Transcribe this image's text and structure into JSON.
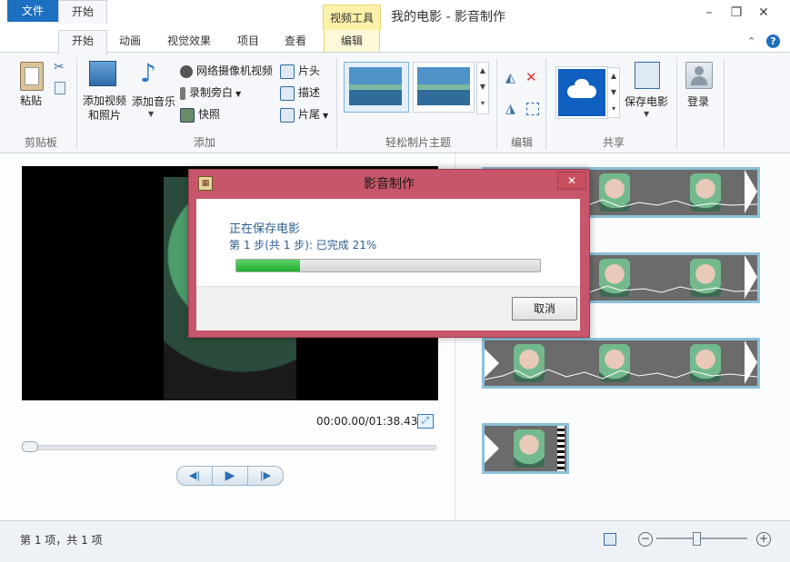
{
  "window": {
    "title": "我的电影 - 影音制作",
    "context_tab_group": "视频工具",
    "minimize": "–",
    "restore": "❐",
    "close": "✕"
  },
  "ribbon_tabs": [
    "文件",
    "开始",
    "动画",
    "视觉效果",
    "项目",
    "查看",
    "编辑"
  ],
  "ribbon": {
    "clipboard": {
      "paste": "粘贴",
      "group": "剪贴板"
    },
    "add": {
      "add_video": "添加视频\n和照片",
      "add_video_line1": "添加视频",
      "add_video_line2": "和照片",
      "add_music": "添加音乐",
      "webcam": "网络摄像机视频",
      "narration": "录制旁白",
      "snapshot": "快照",
      "title": "片头",
      "caption": "描述",
      "credits": "片尾",
      "group": "添加"
    },
    "themes": {
      "group": "轻松制片主题"
    },
    "editing": {
      "group": "编辑"
    },
    "share": {
      "save_movie": "保存电影",
      "group": "共享"
    },
    "signin": {
      "label": "登录"
    }
  },
  "player": {
    "timecode": "00:00.00/01:38.43"
  },
  "status": {
    "text": "第 1 项，共 1 项"
  },
  "dialog": {
    "title": "影音制作",
    "line1": "正在保存电影",
    "line2": "第 1 步(共 1 步): 已完成 21%",
    "progress": 0.21,
    "cancel": "取消",
    "close": "✕"
  },
  "colors": {
    "file_tab": "#1d6fbf",
    "dialog_frame": "#c8566a",
    "progress_fill": "#1fae2c",
    "clip_border": "#8cc0d8"
  }
}
